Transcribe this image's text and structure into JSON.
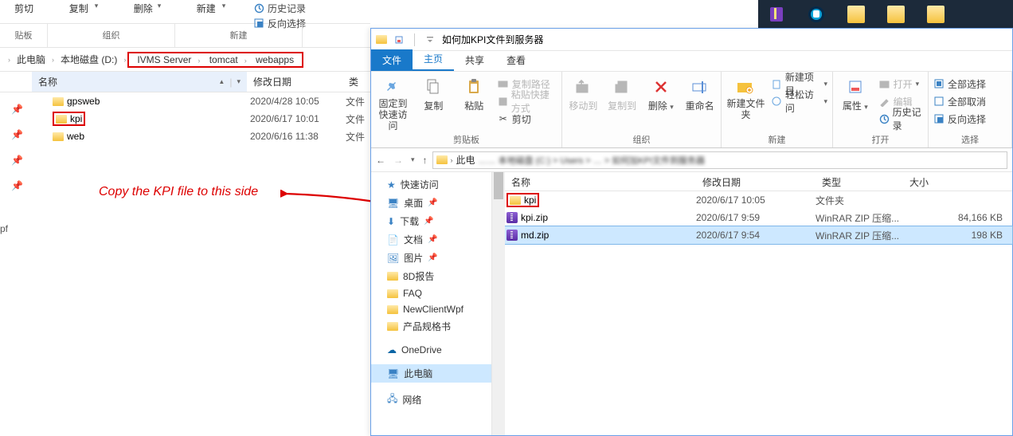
{
  "left": {
    "toolbar_buttons": {
      "cut": "剪切",
      "copy_top": "复制",
      "delete": "删除",
      "new_top": "新建"
    },
    "history_top": "历史记录",
    "invert_top": "反向选择",
    "group_labels": {
      "clipboard": "贴板",
      "organize": "组织",
      "new": "新建"
    },
    "breadcrumb": {
      "pc": "此电脑",
      "drive": "本地磁盘 (D:)",
      "p1": "IVMS Server",
      "p2": "tomcat",
      "p3": "webapps"
    },
    "columns": {
      "name": "名称",
      "date": "修改日期",
      "type": "类"
    },
    "rows": [
      {
        "name": "gpsweb",
        "date": "2020/4/28 10:05",
        "type": "文件",
        "boxed": false
      },
      {
        "name": "kpi",
        "date": "2020/6/17 10:01",
        "type": "文件",
        "boxed": true
      },
      {
        "name": "web",
        "date": "2020/6/16 11:38",
        "type": "文件",
        "boxed": false
      }
    ]
  },
  "bottom_left_fragment": "pf",
  "annotation_text": "Copy the KPI file to this side",
  "right": {
    "window_title": "如何加KPI文件到服务器",
    "tabs": {
      "file": "文件",
      "home": "主页",
      "share": "共享",
      "view": "查看"
    },
    "ribbon": {
      "pin": "固定到快速访问",
      "copy": "复制",
      "paste": "粘贴",
      "copy_path": "复制路径",
      "paste_shortcut": "粘贴快捷方式",
      "cut": "剪切",
      "move_to": "移动到",
      "copy_to": "复制到",
      "delete": "删除",
      "rename": "重命名",
      "new_folder": "新建文件夹",
      "new_item": "新建项目",
      "easy_access": "轻松访问",
      "properties": "属性",
      "open": "打开",
      "edit": "编辑",
      "history": "历史记录",
      "select_all": "全部选择",
      "select_none": "全部取消",
      "invert": "反向选择",
      "groups": {
        "clipboard": "剪贴板",
        "organize": "组织",
        "new": "新建",
        "open": "打开",
        "select": "选择"
      }
    },
    "addr_prefix": "此电",
    "nav": {
      "quick": "快速访问",
      "desktop": "桌面",
      "downloads": "下载",
      "documents": "文档",
      "pictures": "图片",
      "reports": "8D报告",
      "faq": "FAQ",
      "client": "NewClientWpf",
      "spec": "产品规格书",
      "onedrive": "OneDrive",
      "thispc": "此电脑",
      "network": "网络"
    },
    "columns": {
      "name": "名称",
      "date": "修改日期",
      "type": "类型",
      "size": "大小"
    },
    "rows": [
      {
        "icon": "folder",
        "name": "kpi",
        "date": "2020/6/17 10:05",
        "type": "文件夹",
        "size": "",
        "boxed": true
      },
      {
        "icon": "zip",
        "name": "kpi.zip",
        "date": "2020/6/17 9:59",
        "type": "WinRAR ZIP 压缩...",
        "size": "84,166 KB",
        "boxed": false
      },
      {
        "icon": "zip",
        "name": "md.zip",
        "date": "2020/6/17 9:54",
        "type": "WinRAR ZIP 压缩...",
        "size": "198 KB",
        "boxed": false,
        "sel": true
      }
    ]
  }
}
